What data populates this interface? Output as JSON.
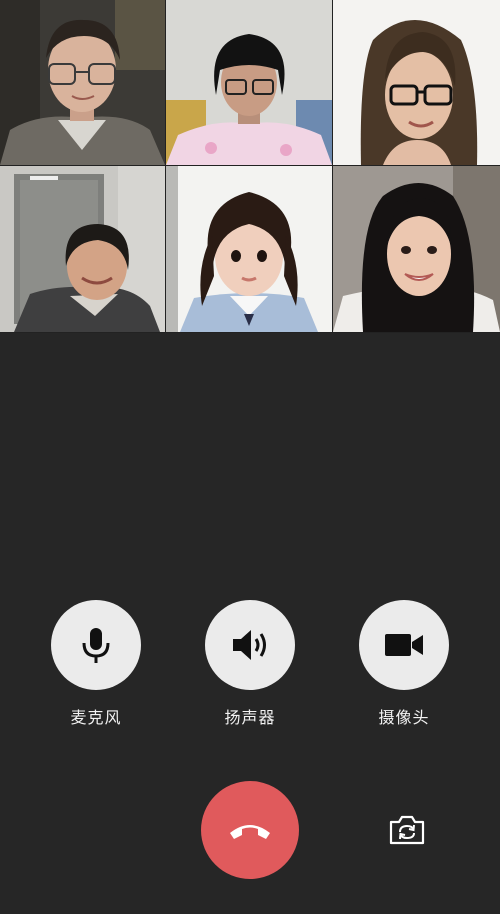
{
  "participants": [
    {
      "id": "participant-1",
      "icon": "man-glasses-video"
    },
    {
      "id": "participant-2",
      "icon": "girl-pink-hoodie-video"
    },
    {
      "id": "participant-3",
      "icon": "woman-glasses-video"
    },
    {
      "id": "participant-4",
      "icon": "woman-office-video"
    },
    {
      "id": "participant-5",
      "icon": "child-portrait-video"
    },
    {
      "id": "participant-6",
      "icon": "young-woman-video"
    }
  ],
  "controls": {
    "microphone_label": "麦克风",
    "speaker_label": "扬声器",
    "camera_label": "摄像头"
  },
  "colors": {
    "background": "#262626",
    "control_circle": "#ebebeb",
    "hangup": "#e05a5c",
    "label_text": "#f2f2f2"
  }
}
